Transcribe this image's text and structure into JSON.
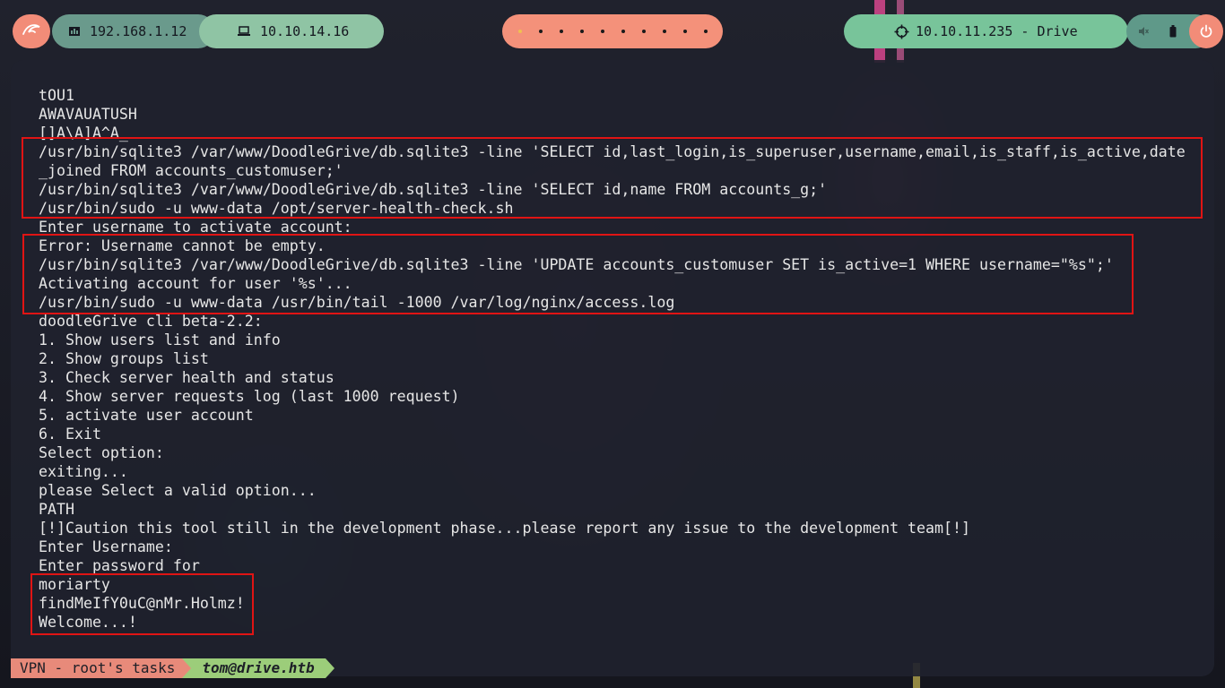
{
  "topbar": {
    "local_ip": "192.168.1.12",
    "vpn_ip": "10.10.14.16",
    "target_label": "10.10.11.235 - Drive",
    "workspaces": 10,
    "active_workspace": 1,
    "icons": {
      "menu": "kali-dragon-icon",
      "local": "network-card-icon",
      "vpn": "laptop-icon",
      "target": "crosshair-icon",
      "volume": "volume-muted-icon",
      "battery": "battery-icon",
      "power": "power-icon"
    },
    "colors": {
      "accent": "#f28c78",
      "green": "#8fc4a4",
      "teal": "#6a9a8c"
    }
  },
  "terminal": {
    "lines": [
      "tOU1",
      "AWAVAUATUSH",
      "[]A\\A]A^A_",
      "/usr/bin/sqlite3 /var/www/DoodleGrive/db.sqlite3 -line 'SELECT id,last_login,is_superuser,username,email,is_staff,is_active,date",
      "_joined FROM accounts_customuser;'",
      "/usr/bin/sqlite3 /var/www/DoodleGrive/db.sqlite3 -line 'SELECT id,name FROM accounts_g;'",
      "/usr/bin/sudo -u www-data /opt/server-health-check.sh",
      "Enter username to activate account:",
      "Error: Username cannot be empty.",
      "/usr/bin/sqlite3 /var/www/DoodleGrive/db.sqlite3 -line 'UPDATE accounts_customuser SET is_active=1 WHERE username=\"%s\";'",
      "Activating account for user '%s'...",
      "/usr/bin/sudo -u www-data /usr/bin/tail -1000 /var/log/nginx/access.log",
      "doodleGrive cli beta-2.2:",
      "1. Show users list and info",
      "2. Show groups list",
      "3. Check server health and status",
      "4. Show server requests log (last 1000 request)",
      "5. activate user account",
      "6. Exit",
      "Select option:",
      "exiting...",
      "please Select a valid option...",
      "PATH",
      "[!]Caution this tool still in the development phase...please report any issue to the development team[!]",
      "Enter Username:",
      "Enter password for",
      "moriarty",
      "findMeIfY0uC@nMr.Holmz!",
      "Welcome...!"
    ],
    "highlight_color": "#e01414"
  },
  "statusbar": {
    "session": "VPN - root's tasks",
    "user_host": "tom@drive.htb"
  }
}
